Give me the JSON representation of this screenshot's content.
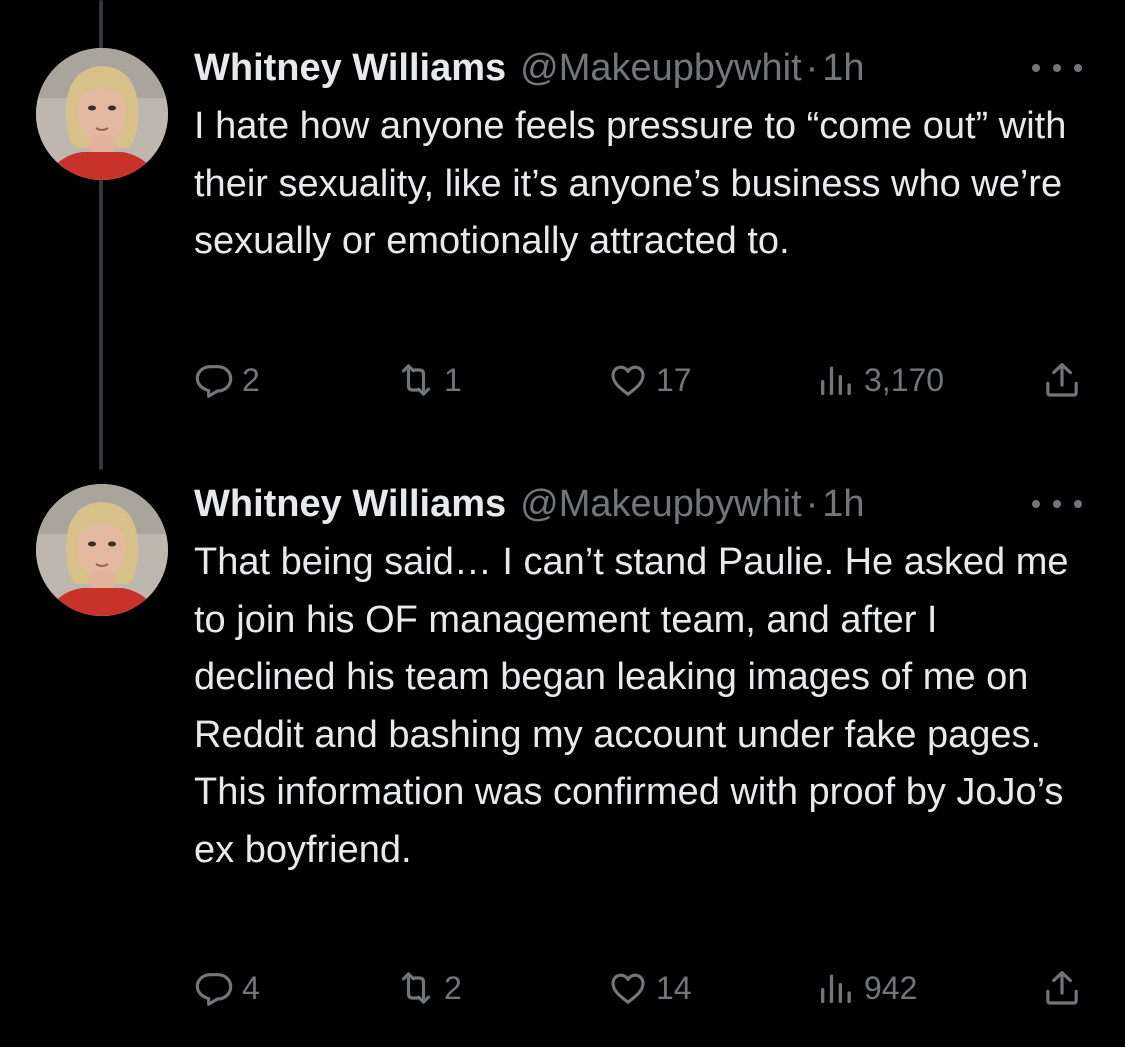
{
  "tweets": [
    {
      "author_name": "Whitney Williams",
      "handle": "@Makeupbywhit",
      "separator": "·",
      "time": "1h",
      "text": "I hate how anyone feels pressure to “come out” with their sexuality, like it’s anyone’s business who we’re sexually or emotionally attracted to.",
      "replies": "2",
      "retweets": "1",
      "likes": "17",
      "views": "3,170"
    },
    {
      "author_name": "Whitney Williams",
      "handle": "@Makeupbywhit",
      "separator": "·",
      "time": "1h",
      "text": "That being said… I can’t stand Paulie. He asked me to join his OF management team, and after I declined his team began leaking images of me on Reddit and bashing my account under fake pages. This information was confirmed with proof by JoJo’s ex boyfriend.",
      "replies": "4",
      "retweets": "2",
      "likes": "14",
      "views": "942"
    }
  ],
  "icons": {
    "reply": "reply-icon",
    "retweet": "retweet-icon",
    "like": "heart-icon",
    "views": "views-icon",
    "share": "share-icon",
    "more": "more-icon"
  },
  "colors": {
    "background": "#000000",
    "primary_text": "#e7e9ea",
    "secondary_text": "#71767b",
    "thread_line": "#333639"
  }
}
